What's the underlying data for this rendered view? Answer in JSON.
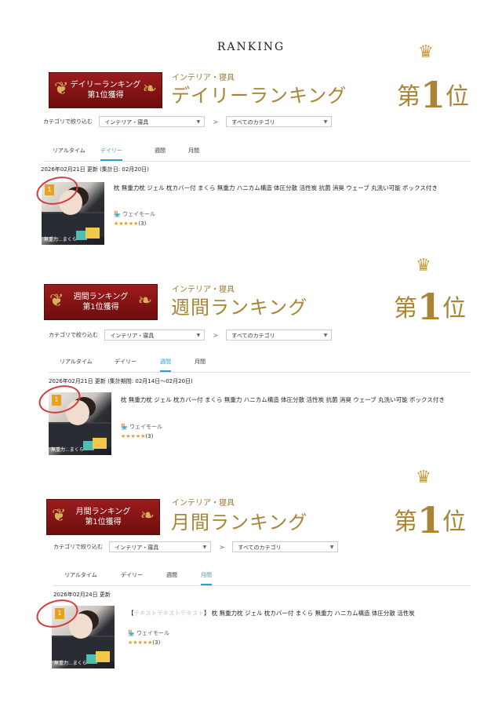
{
  "page_title": "RANKING",
  "sections": [
    {
      "banner": {
        "line1": "デイリーランキング",
        "line2": "第1位獲得"
      },
      "category_small": "インテリア・寝具",
      "category_big": "デイリーランキング",
      "rank_label": {
        "pre": "第",
        "num": "1",
        "post": "位"
      },
      "filter": {
        "label": "カテゴリで絞り込む",
        "select1": "インテリア・寝具",
        "sep": ">",
        "select2": "すべてのカテゴリ"
      },
      "tabs": [
        "リアルタイム",
        "デイリー",
        "週間",
        "月間"
      ],
      "active_tab": "デイリー",
      "updated": "2026年02月21日 更新 (集計日: 02月20日)",
      "product": {
        "rank": "1",
        "title": "枕 無重力枕 ジェル 枕カバー付 まくら 無重力 ハニカム構造 体圧分散 活性炭 抗菌 消臭 ウェーブ 丸洗い可能 ボックス付き",
        "shop": "ウェイモール",
        "stars": "★★★★★",
        "reviews": "(3)",
        "thumb_caption": "無重力...まくら"
      }
    },
    {
      "banner": {
        "line1": "週間ランキング",
        "line2": "第1位獲得"
      },
      "category_small": "インテリア・寝具",
      "category_big": "週間ランキング",
      "rank_label": {
        "pre": "第",
        "num": "1",
        "post": "位"
      },
      "filter": {
        "label": "カテゴリで絞り込む",
        "select1": "インテリア・寝具",
        "sep": ">",
        "select2": "すべてのカテゴリ"
      },
      "tabs": [
        "リアルタイム",
        "デイリー",
        "週間",
        "月間"
      ],
      "active_tab": "週間",
      "updated": "2026年02月21日 更新 (集計期間: 02月14日〜02月20日)",
      "product": {
        "rank": "1",
        "title": "枕 無重力枕 ジェル 枕カバー付 まくら 無重力 ハニカム構造 体圧分散 活性炭 抗菌 消臭 ウェーブ 丸洗い可能 ボックス付き",
        "shop": "ウェイモール",
        "stars": "★★★★★",
        "reviews": "(3)",
        "thumb_caption": "無重力...まくら"
      }
    },
    {
      "banner": {
        "line1": "月間ランキング",
        "line2": "第1位獲得"
      },
      "category_small": "インテリア・寝具",
      "category_big": "月間ランキング",
      "rank_label": {
        "pre": "第",
        "num": "1",
        "post": "位"
      },
      "filter": {
        "label": "カテゴリで絞り込む",
        "select1": "インテリア・寝具",
        "sep": ">",
        "select2": "すべてのカテゴリ"
      },
      "tabs": [
        "リアルタイム",
        "デイリー",
        "週間",
        "月間"
      ],
      "active_tab": "月間",
      "updated": "2026年02月24日 更新",
      "product": {
        "rank": "1",
        "title_prefix": "【",
        "title_blurred": "テキストテキストテキスト",
        "title": "】 枕 無重力枕 ジェル 枕カバー付 まくら 無重力 ハニカム構造 体圧分散 活性炭",
        "shop": "ウェイモール",
        "stars": "★★★★★",
        "reviews": "(3)",
        "thumb_caption": "無重力...まくら"
      }
    }
  ],
  "colors": {
    "gold": "#a98434",
    "banner_red": "#8b1717",
    "tab_active": "#2a9fd6",
    "circle": "#d23b3b"
  }
}
